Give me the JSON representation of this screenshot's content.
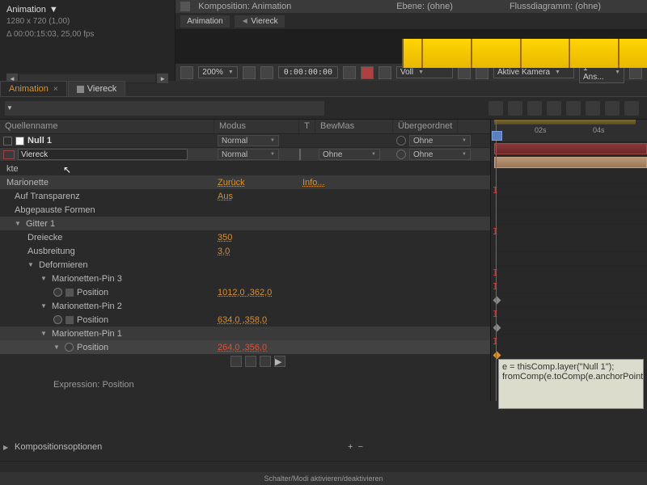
{
  "project": {
    "title": "Animation",
    "resolution": "1280 x 720 (1,00)",
    "duration": "Δ 00:00:15:03, 25,00 fps"
  },
  "comp_header": {
    "komposition": "Komposition: Animation",
    "ebene": "Ebene: (ohne)",
    "flussdiagramm": "Flussdiagramm: (ohne)"
  },
  "comp_tabs": {
    "animation": "Animation",
    "viereck": "Viereck"
  },
  "comp_controls": {
    "zoom": "200%",
    "timecode": "0:00:00:00",
    "resolution": "Voll",
    "camera": "Aktive Kamera",
    "views": "1 Ans..."
  },
  "timeline_tabs": {
    "animation": "Animation",
    "viereck": "Viereck"
  },
  "columns": {
    "name": "Quellenname",
    "mode": "Modus",
    "t": "T",
    "bew": "BewMas",
    "parent": "Übergeordnet"
  },
  "layers": [
    {
      "name": "Null 1",
      "mode": "Normal",
      "parent": "Ohne"
    },
    {
      "name": "Viereck",
      "mode": "Normal",
      "bew": "Ohne",
      "parent": "Ohne"
    }
  ],
  "props": {
    "ekte": "kte",
    "marionette": "Marionette",
    "zurueck": "Zurück",
    "info": "Info...",
    "auf_transparenz": "Auf Transparenz",
    "aus": "Aus",
    "abgepauste": "Abgepauste Formen",
    "gitter": "Gitter 1",
    "dreiecke": "Dreiecke",
    "dreiecke_val": "350",
    "ausbreitung": "Ausbreitung",
    "ausbreitung_val": "3,0",
    "deformieren": "Deformieren",
    "pin3": "Marionetten-Pin 3",
    "pin3_pos": "1012,0 ,362,0",
    "pin2": "Marionetten-Pin 2",
    "pin2_pos": "634,0 ,358,0",
    "pin1": "Marionetten-Pin 1",
    "pin1_pos": "264,0 ,356,0",
    "position": "Position",
    "expr_label": "Expression: Position",
    "komp_opt": "Kompositionsoptionen"
  },
  "ruler": {
    "t1": "02s",
    "t2": "04s"
  },
  "expression": {
    "line1": "e = thisComp.layer(\"Null 1\");",
    "line2": "fromComp(e.toComp(e.anchorPoint))"
  },
  "footer": {
    "plus": "+",
    "minus": "−",
    "toggle": "Schalter/Modi aktivieren/deaktivieren"
  }
}
